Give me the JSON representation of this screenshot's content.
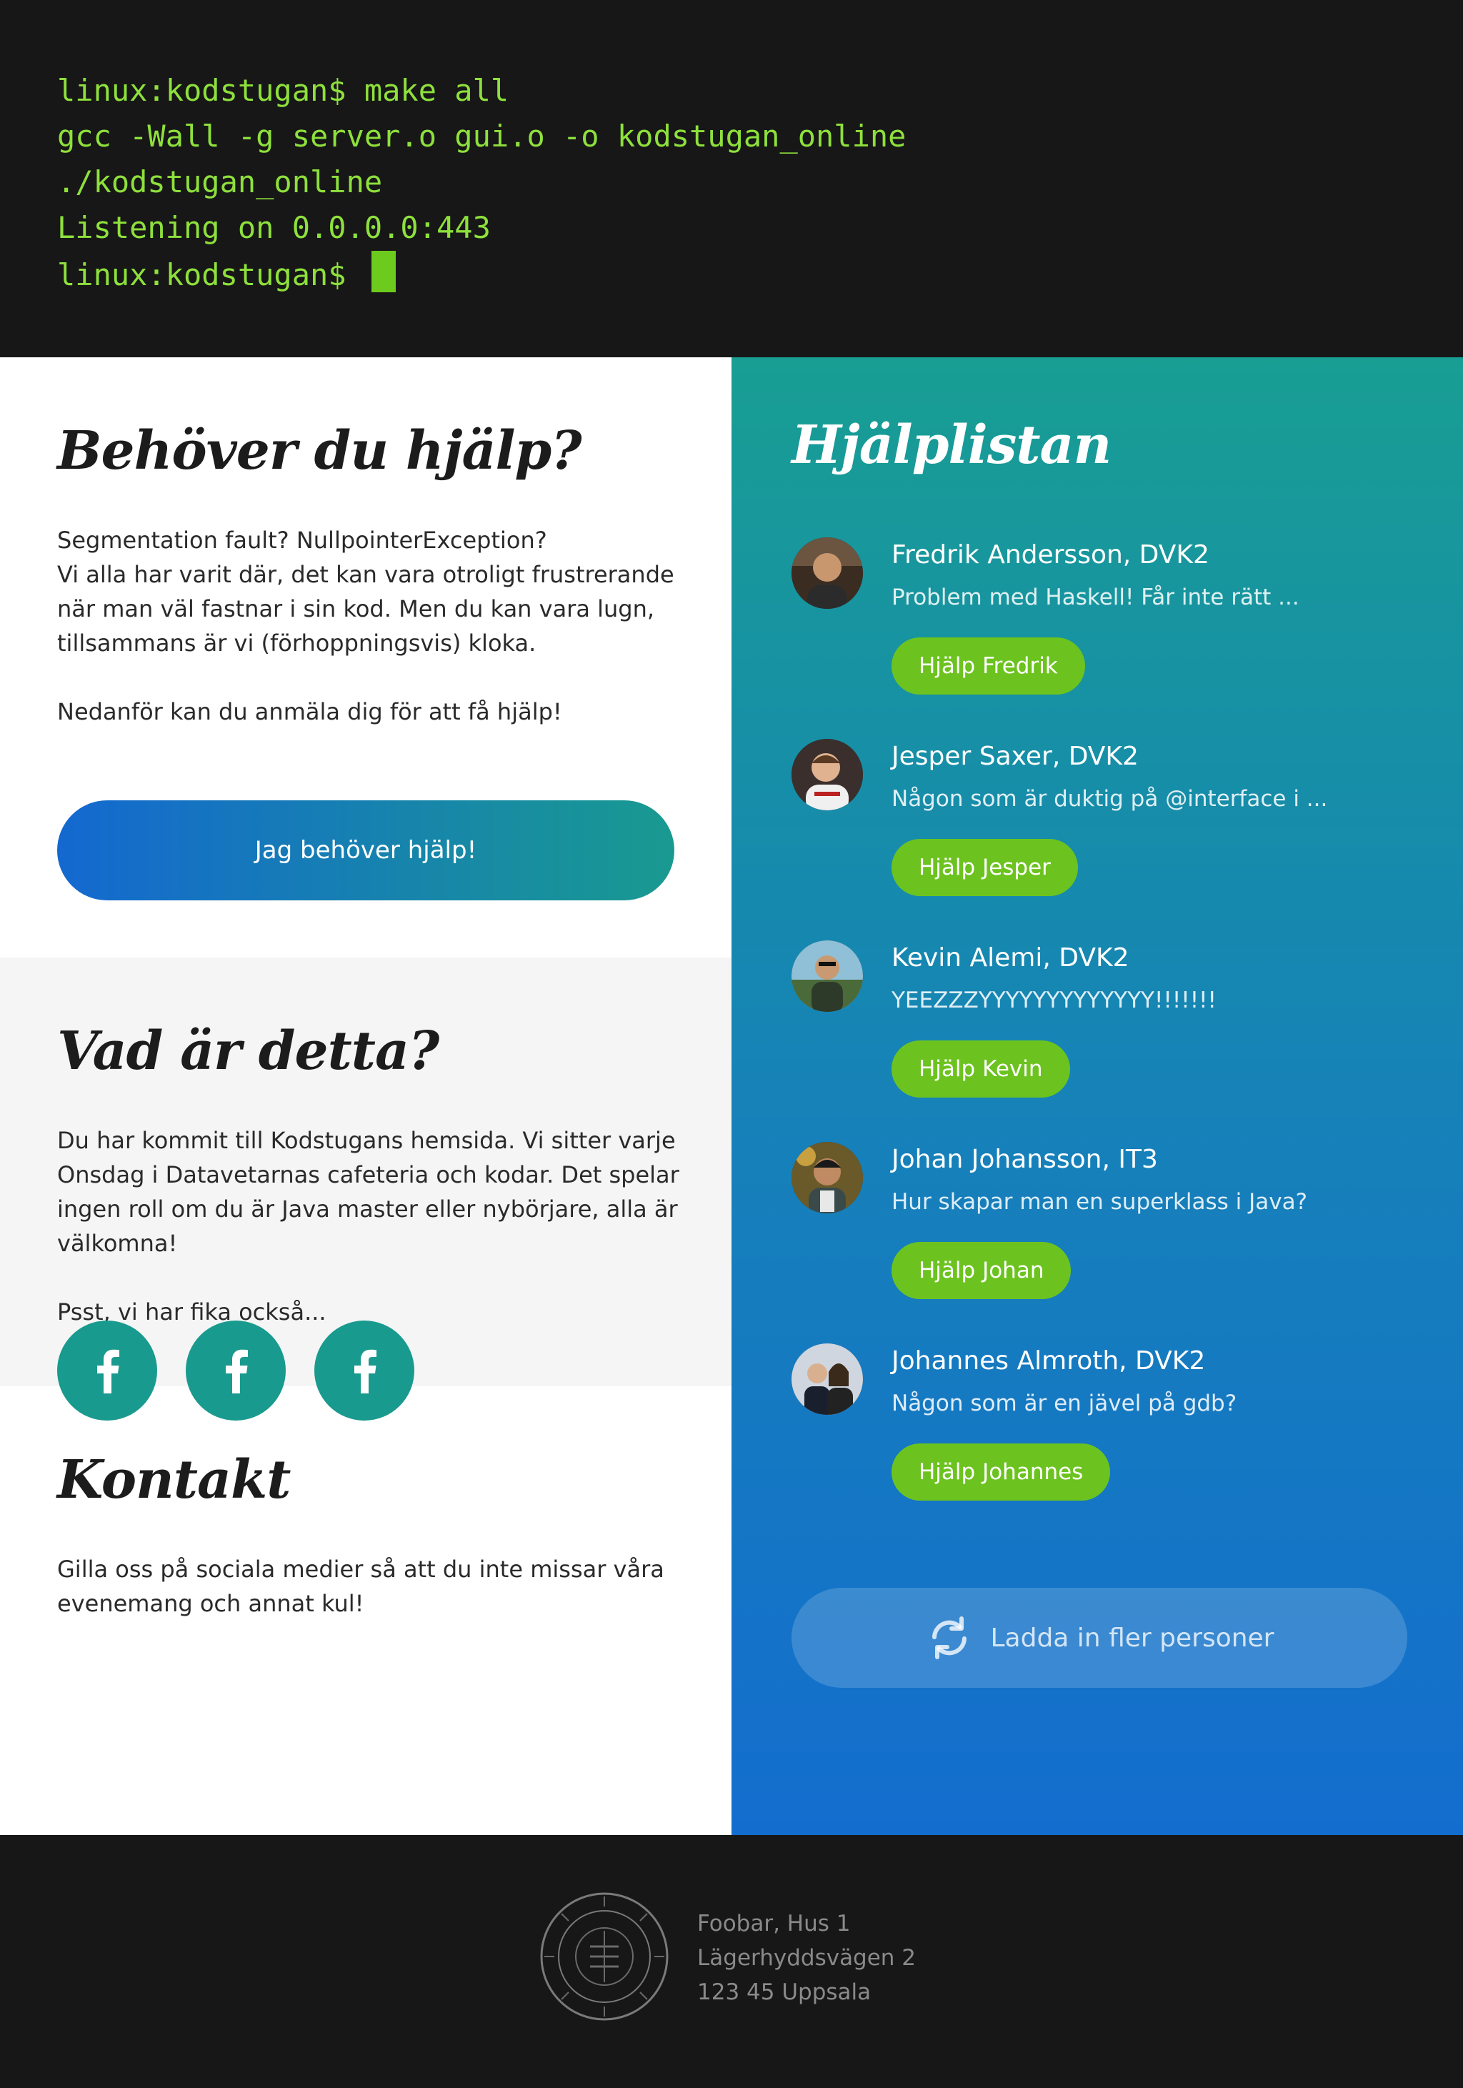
{
  "terminal": {
    "lines": [
      "linux:kodstugan$ make all",
      "gcc -Wall -g server.o gui.o -o kodstugan_online",
      "./kodstugan_online",
      "Listening on 0.0.0.0:443"
    ],
    "prompt": "linux:kodstugan$ "
  },
  "help_section": {
    "title": "Behöver du hjälp?",
    "paragraph1": "Segmentation fault? NullpointerException?\nVi alla har varit där, det kan vara otroligt frustrerande när man väl fastnar i sin kod. Men du kan vara lugn, tillsammans är vi (förhoppningsvis) kloka.",
    "paragraph2": "Nedanför kan du anmäla dig för att få hjälp!",
    "button_label": "Jag behöver hjälp!"
  },
  "about_section": {
    "title": "Vad är detta?",
    "paragraph1": "Du har kommit till Kodstugans hemsida. Vi sitter varje Onsdag i Datavetarnas cafeteria och kodar. Det spelar ingen roll om du är Java master eller nybörjare, alla är välkomna!",
    "paragraph2": "Psst, vi har fika också..."
  },
  "contact_section": {
    "title": "Kontakt",
    "paragraph": "Gilla oss på sociala medier så att du inte missar våra evenemang och annat kul!",
    "social_icons": [
      "facebook-icon",
      "facebook-icon",
      "facebook-icon"
    ]
  },
  "help_list": {
    "title": "Hjälplistan",
    "people": [
      {
        "name": "Fredrik Andersson, DVK2",
        "message": "Problem med Haskell! Får inte rätt ...",
        "button": "Hjälp Fredrik"
      },
      {
        "name": "Jesper Saxer, DVK2",
        "message": "Någon som är duktig på @interface i ...",
        "button": "Hjälp Jesper"
      },
      {
        "name": "Kevin Alemi, DVK2",
        "message": "YEEZZZYYYYYYYYYYYYY!!!!!!!",
        "button": "Hjälp Kevin"
      },
      {
        "name": "Johan Johansson, IT3",
        "message": "Hur skapar man en superklass i Java?",
        "button": "Hjälp Johan"
      },
      {
        "name": "Johannes Almroth, DVK2",
        "message": "Någon som är en jävel på gdb?",
        "button": "Hjälp Johannes"
      }
    ],
    "load_more_label": "Ladda in fler personer"
  },
  "footer": {
    "address_line1": "Foobar, Hus 1",
    "address_line2": "Lägerhyddsvägen 2",
    "address_line3": "123 45 Uppsala"
  },
  "colors": {
    "terminal_green": "#8ee03c",
    "accent_teal": "#199a8e",
    "accent_blue": "#136dce",
    "button_green": "#6cc31f"
  }
}
